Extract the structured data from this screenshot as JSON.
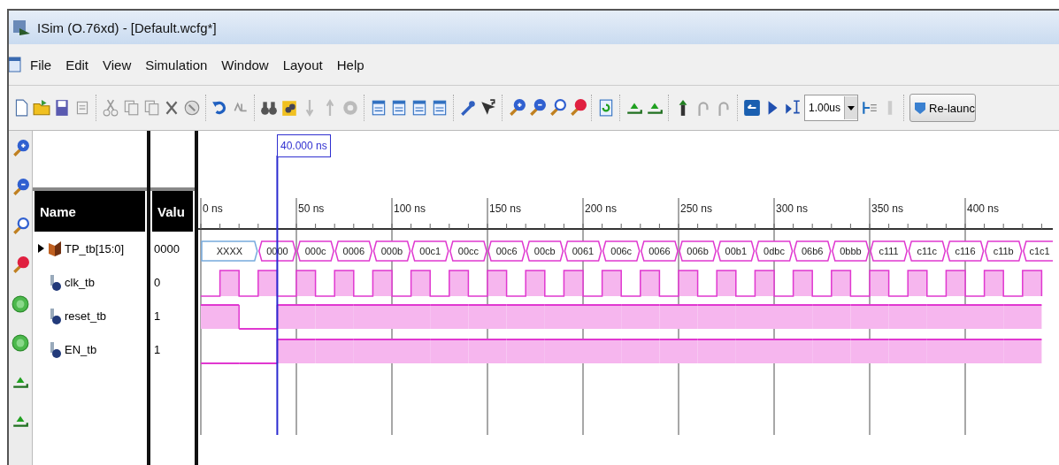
{
  "window": {
    "title": "ISim (O.76xd) - [Default.wcfg*]"
  },
  "menu": [
    "File",
    "Edit",
    "View",
    "Simulation",
    "Window",
    "Layout",
    "Help"
  ],
  "toolbar": {
    "time_field": {
      "value": "1.00us"
    },
    "relaunch_button": {
      "label": "Re-launc"
    }
  },
  "columns": {
    "name": "Name",
    "value": "Valu"
  },
  "cursor": {
    "label": "40.000 ns"
  },
  "ruler": [
    "0 ns",
    "50 ns",
    "100 ns",
    "150 ns",
    "200 ns",
    "250 ns",
    "300 ns",
    "350 ns",
    "400 ns"
  ],
  "signals": [
    {
      "name": "TP_tb[15:0]",
      "value": "0000",
      "kind": "bus",
      "expanded": false,
      "segments": [
        {
          "text": "XXXX",
          "kind": "unknown"
        },
        {
          "text": "0000",
          "kind": "value"
        },
        {
          "text": "000c",
          "kind": "value"
        },
        {
          "text": "0006",
          "kind": "value"
        },
        {
          "text": "000b",
          "kind": "value"
        },
        {
          "text": "00c1",
          "kind": "value"
        },
        {
          "text": "00cc",
          "kind": "value"
        },
        {
          "text": "00c6",
          "kind": "value"
        },
        {
          "text": "00cb",
          "kind": "value"
        },
        {
          "text": "0061",
          "kind": "value"
        },
        {
          "text": "006c",
          "kind": "value"
        },
        {
          "text": "0066",
          "kind": "value"
        },
        {
          "text": "006b",
          "kind": "value"
        },
        {
          "text": "00b1",
          "kind": "value"
        },
        {
          "text": "0dbc",
          "kind": "value"
        },
        {
          "text": "06b6",
          "kind": "value"
        },
        {
          "text": "0bbb",
          "kind": "value"
        },
        {
          "text": "c111",
          "kind": "value"
        },
        {
          "text": "c11c",
          "kind": "value"
        },
        {
          "text": "c116",
          "kind": "value"
        },
        {
          "text": "c11b",
          "kind": "value"
        },
        {
          "text": "c1c1",
          "kind": "value"
        }
      ]
    },
    {
      "name": "clk_tb",
      "value": "0",
      "kind": "clock"
    },
    {
      "name": "reset_tb",
      "value": "1",
      "kind": "bit",
      "high": [
        true,
        false,
        true,
        true,
        true,
        true,
        true,
        true,
        true,
        true,
        true,
        true,
        true,
        true,
        true,
        true,
        true,
        true,
        true,
        true,
        true,
        true
      ]
    },
    {
      "name": "EN_tb",
      "value": "1",
      "kind": "bit",
      "high": [
        false,
        false,
        true,
        true,
        true,
        true,
        true,
        true,
        true,
        true,
        true,
        true,
        true,
        true,
        true,
        true,
        true,
        true,
        true,
        true,
        true,
        true
      ]
    }
  ]
}
